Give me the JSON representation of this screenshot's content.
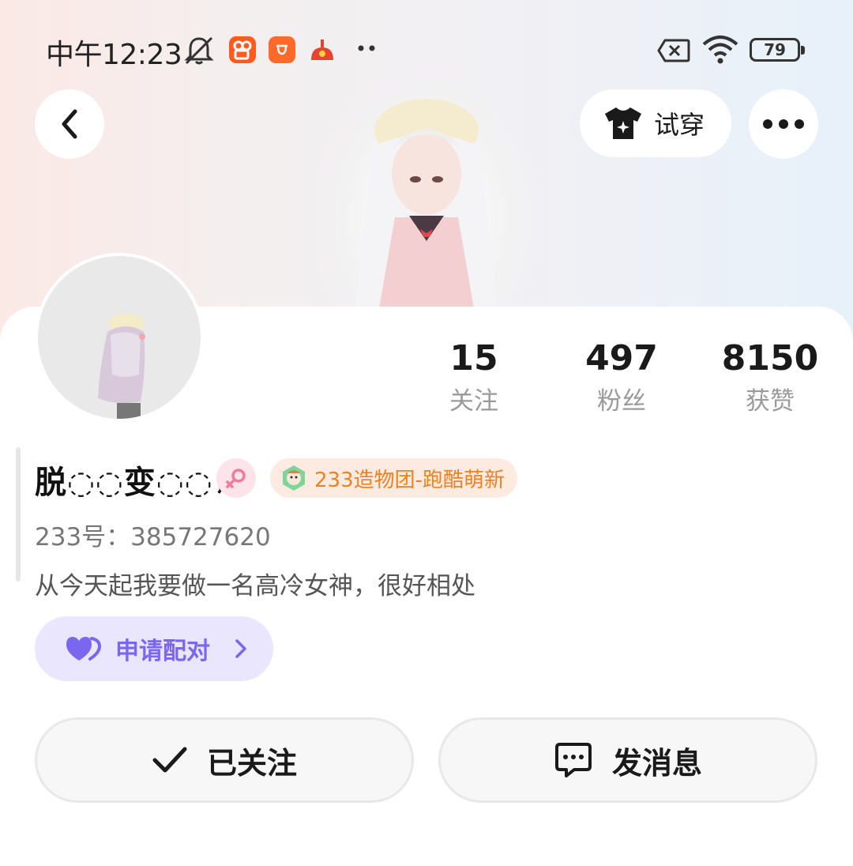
{
  "status_bar": {
    "time": "中午12:23",
    "battery": "79",
    "icons": [
      "mute-bell-icon",
      "kuaishou-app-icon",
      "xiaomi-store-icon",
      "game-app-icon",
      "more-dots-icon",
      "sim-x-icon",
      "wifi-icon",
      "battery-icon"
    ]
  },
  "header": {
    "back_icon": "chevron-left-icon",
    "tryon_label": "试穿",
    "tryon_icon": "tshirt-icon",
    "more_icon": "more-horizontal-icon"
  },
  "profile": {
    "username": "脱◌◌变◌◌⸙",
    "gender": "female",
    "group_tag": "233造物团-跑酷萌新",
    "uid": "233号：385727620",
    "bio": "从今天起我要做一名高冷女神，很好相处",
    "pair_button": "申请配对"
  },
  "stats": [
    {
      "value": "15",
      "label": "关注"
    },
    {
      "value": "497",
      "label": "粉丝"
    },
    {
      "value": "8150",
      "label": "获赞"
    }
  ],
  "actions": {
    "follow_label": "已关注",
    "message_label": "发消息"
  },
  "colors": {
    "accent_purple": "#7b66f0",
    "pair_bg": "#e9e6fd",
    "tag_orange": "#f08020",
    "gender_pink": "#f27a9a"
  }
}
